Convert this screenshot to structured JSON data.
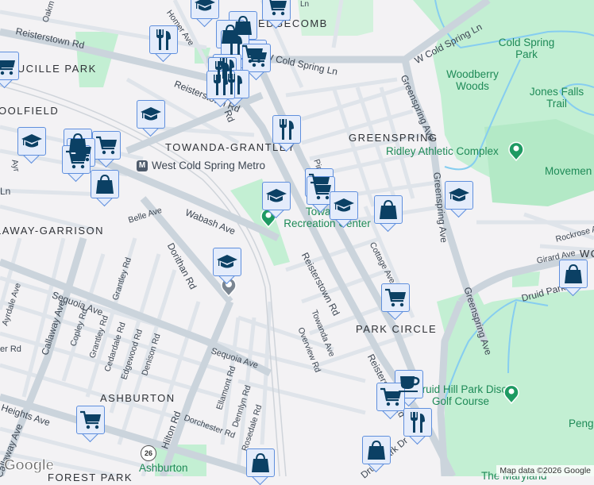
{
  "map": {
    "neighborhoods": [
      "EDGECOMB",
      "LUCILLE PARK",
      "OOLFIELD",
      "TOWANDA-GRANTLEY",
      "GREENSPRING",
      "LAWAY-GARRISON",
      "PARK CIRCLE",
      "ASHBURTON",
      "FOREST PARK",
      "WO"
    ],
    "streets": [
      "Reisterstown Rd",
      "Reisterstown Rd",
      "Reisterstown Rd",
      "Reisterstown Rd",
      "W Cold Spring Ln",
      "W Cold Spring Ln",
      "Greenspring Ave",
      "Greenspring Ave",
      "Greenspring Ave",
      "Wabash Ave",
      "Belle Ave",
      "Dorithan Rd",
      "Sequoia Ave",
      "Sequoia Ave",
      "Callaway Ave",
      "Callaway Ave",
      "Copley Rd",
      "Grantley Rd",
      "Grantley Rd",
      "Cedardale Rd",
      "Edgewood Rd",
      "Denison Rd",
      "Ayrdale Ave",
      "Heights Ave",
      "Hilton Rd",
      "Dorchester Rd",
      "Ellamont Rd",
      "Dennlyn Rd",
      "Rosedale Rd",
      "Towanda Ave",
      "Overview Rd",
      "Cottage Ave",
      "Girard Ave",
      "Rockrose Ave",
      "Druid Park Dr",
      "Druid Park Dr",
      "Homer Ave",
      "Oakm",
      "Pim",
      "Ln",
      "Ayr",
      "er Rd",
      "Rd",
      "Ln"
    ],
    "parks": {
      "cold_spring": "Cold Spring Park",
      "woodberry": "Woodberry Woods",
      "jones_falls": "Jones Falls Trail",
      "ridley": "Ridley Athletic Complex",
      "movement": "Movemen",
      "towanda": "Towanda Recreation Center",
      "druid": "Druid Hill Park Disc Golf Course",
      "peng": "Peng",
      "ashburton": "Ashburton",
      "maryland": "The Maryland"
    },
    "metro_station": "West Cold Spring Metro",
    "route_shield": "26",
    "logo": "Google",
    "attribution": "Map data ©2026 Google"
  },
  "markers": [
    "school",
    "cart",
    "bag",
    "bag",
    "fork",
    "cart",
    "fork",
    "fork",
    "fork",
    "cart",
    "fork",
    "fork",
    "school",
    "school",
    "bag",
    "cart",
    "cart",
    "cart",
    "bag",
    "fork",
    "cart",
    "cart",
    "school",
    "school",
    "bag",
    "school",
    "school",
    "cart",
    "bag",
    "coffee",
    "cart",
    "fork",
    "bag",
    "cart",
    "bag",
    "cart"
  ],
  "colors": {
    "marker_bg": "#e4ecfb",
    "marker_border": "#5f8fdd",
    "icon": "#0b4064",
    "park": "#c3efd3",
    "water": "#86cdf0",
    "road": "#d6dde3"
  }
}
